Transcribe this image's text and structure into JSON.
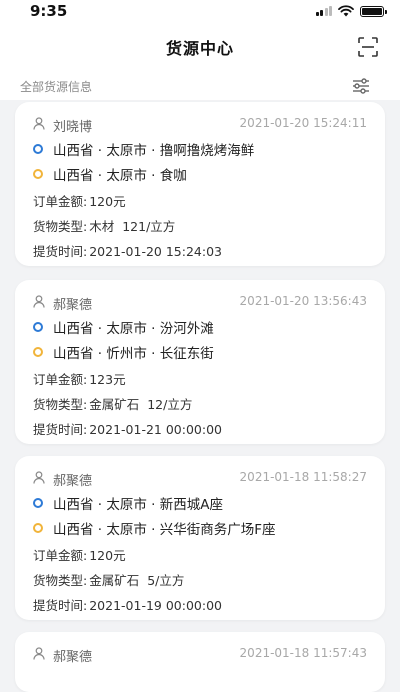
{
  "status_bar": {
    "time": "9:35"
  },
  "header": {
    "title": "货源中心",
    "scan_icon": "scan-icon"
  },
  "subbar": {
    "label": "全部货源信息",
    "filter_icon": "filter-icon"
  },
  "colors": {
    "start_dot": "#2d7ad6",
    "end_dot": "#f1b43a"
  },
  "orders": [
    {
      "name": "刘晓博",
      "time": "2021-01-20 15:24:11",
      "from": "山西省 · 太原市 · 撸啊撸烧烤海鲜",
      "to": "山西省 · 太原市 · 食咖",
      "amount_label": "订单金额:",
      "amount": "120元",
      "type_label": "货物类型:",
      "type": "木材",
      "volume": "121/立方",
      "pickup_label": "提货时间:",
      "pickup": "2021-01-20 15:24:03"
    },
    {
      "name": "郝聚德",
      "time": "2021-01-20 13:56:43",
      "from": "山西省 · 太原市 · 汾河外滩",
      "to": "山西省 · 忻州市 · 长征东街",
      "amount_label": "订单金额:",
      "amount": "123元",
      "type_label": "货物类型:",
      "type": "金属矿石",
      "volume": "12/立方",
      "pickup_label": "提货时间:",
      "pickup": "2021-01-21 00:00:00"
    },
    {
      "name": "郝聚德",
      "time": "2021-01-18 11:58:27",
      "from": "山西省 · 太原市 · 新西城A座",
      "to": "山西省 · 太原市 · 兴华街商务广场F座",
      "amount_label": "订单金额:",
      "amount": "120元",
      "type_label": "货物类型:",
      "type": "金属矿石",
      "volume": "5/立方",
      "pickup_label": "提货时间:",
      "pickup": "2021-01-19 00:00:00"
    },
    {
      "name": "郝聚德",
      "time": "2021-01-18 11:57:43"
    }
  ]
}
